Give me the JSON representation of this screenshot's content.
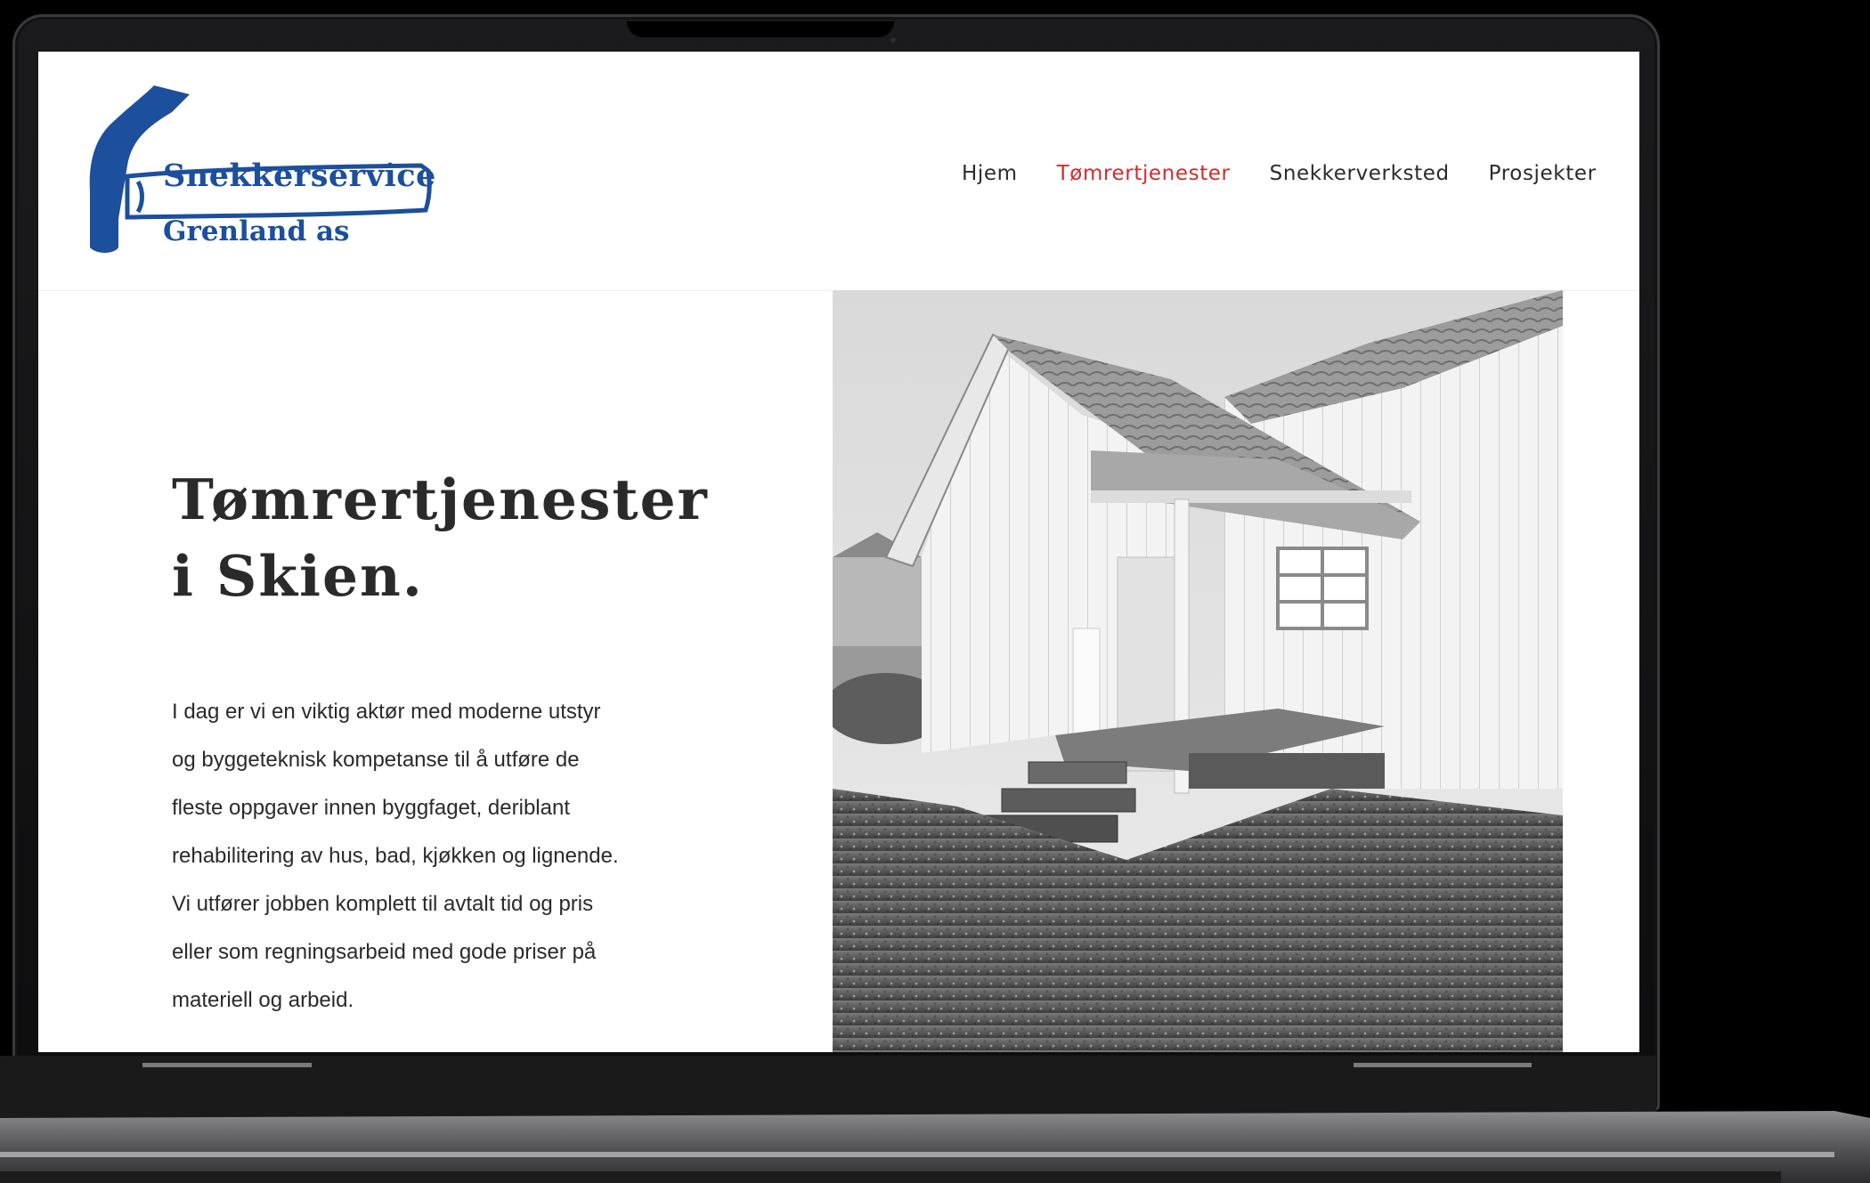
{
  "brand": {
    "line1": "Snekkerservice",
    "line2": "Grenland as",
    "color": "#1c4f9c"
  },
  "nav": {
    "items": [
      {
        "label": "Hjem",
        "active": false
      },
      {
        "label": "Tømrertjenester",
        "active": true
      },
      {
        "label": "Snekkerverksted",
        "active": false
      },
      {
        "label": "Prosjekter",
        "active": false
      }
    ],
    "active_color": "#d12c2c"
  },
  "hero": {
    "title_line1": "Tømrertjenester",
    "title_line2": "i Skien.",
    "body_lines": [
      "I dag er vi en viktig aktør med moderne utstyr",
      "og byggeteknisk kompetanse til å utføre de",
      "fleste oppgaver innen byggfaget, deriblant",
      "rehabilitering av hus, bad, kjøkken og lignende.",
      "Vi utfører jobben komplett til avtalt tid og pris",
      "eller som regningsarbeid med gode priser på",
      "materiell og arbeid."
    ]
  },
  "image": {
    "subject": "black-and-white photo of a white wooden house extension with a covered porch and steps"
  }
}
